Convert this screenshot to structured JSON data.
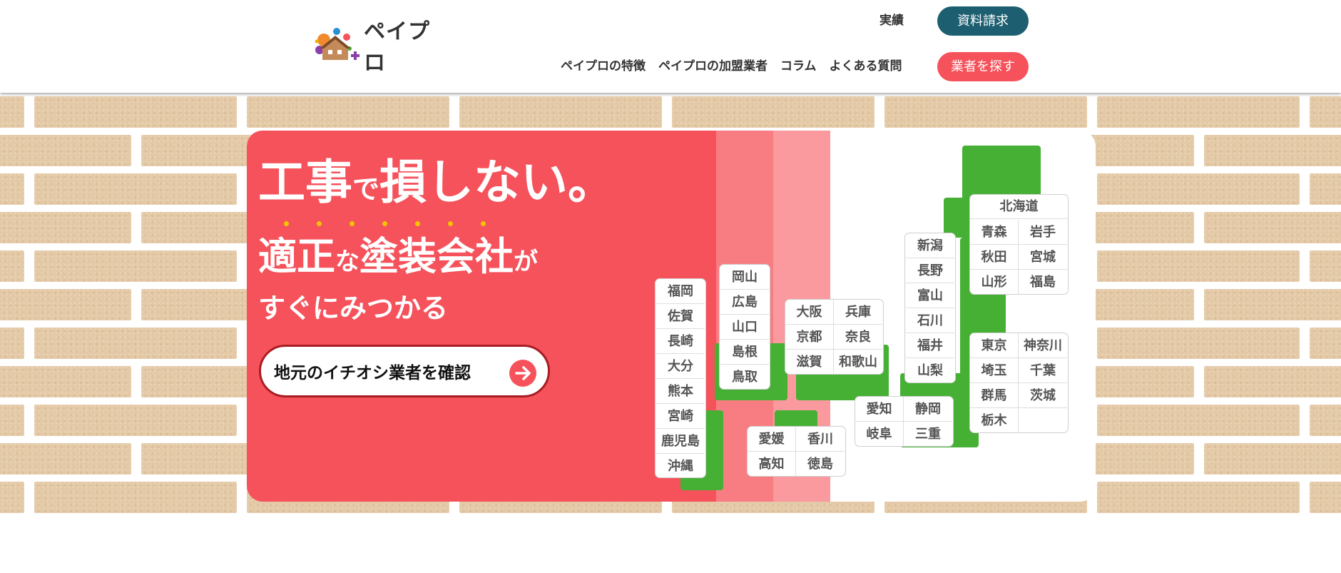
{
  "header": {
    "logo_text": "ペイプロ",
    "top_link": "実績",
    "request_button": "資料請求",
    "find_button": "業者を探す",
    "nav": [
      "ペイプロの特徴",
      "ペイプロの加盟業者",
      "コラム",
      "よくある質問"
    ]
  },
  "hero": {
    "headline_part1": "工事",
    "headline_part2": "で",
    "headline_part3": "損しない。",
    "line2_part1": "適正",
    "line2_part2": "な",
    "line2_part3": "塗装会社",
    "line2_part4": "が",
    "line3": "すぐにみつかる",
    "cta_label": "地元のイチオシ業者を確認"
  },
  "map": {
    "kyushu": [
      "福岡",
      "佐賀",
      "長崎",
      "大分",
      "熊本",
      "宮崎",
      "鹿児島",
      "沖縄"
    ],
    "chugoku": [
      "岡山",
      "広島",
      "山口",
      "島根",
      "鳥取"
    ],
    "kansai": [
      "大阪",
      "兵庫",
      "京都",
      "奈良",
      "滋賀",
      "和歌山"
    ],
    "shikoku": [
      "愛媛",
      "香川",
      "高知",
      "徳島"
    ],
    "hokuriku": [
      "新潟",
      "長野",
      "富山",
      "石川",
      "福井",
      "山梨"
    ],
    "tokai": [
      "愛知",
      "静岡",
      "岐阜",
      "三重"
    ],
    "tohoku_title": "北海道",
    "tohoku": [
      "青森",
      "岩手",
      "秋田",
      "宮城",
      "山形",
      "福島"
    ],
    "kanto": [
      "東京",
      "神奈川",
      "埼玉",
      "千葉",
      "群馬",
      "茨城",
      "栃木"
    ]
  },
  "colors": {
    "accent_red": "#f5525b",
    "header_teal": "#1d5f70",
    "map_green": "#46b035",
    "brick": "#e4c9a6"
  }
}
